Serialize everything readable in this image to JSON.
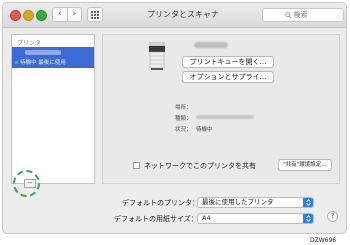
{
  "window": {
    "title": "プリンタとスキャナ",
    "nav_back": "‹",
    "nav_forward": "›"
  },
  "search": {
    "placeholder": "検索"
  },
  "sidebar": {
    "header": "プリンタ",
    "printer_status": "待機中 最後に使用",
    "remove_label": "−"
  },
  "detail": {
    "open_queue_label": "プリントキューを開く…",
    "options_label": "オプションとサプライ…",
    "location_label": "場所：",
    "kind_label": "種類：",
    "status_label": "状況：",
    "status_value": "待機中"
  },
  "share": {
    "label": "ネットワークでこのプリンタを共有",
    "settings_label": "\"共有\"環境設定…"
  },
  "defaults": {
    "printer_label": "デフォルトのプリンタ：",
    "printer_value": "最後に使用したプリンタ",
    "paper_label": "デフォルトの用紙サイズ：",
    "paper_value": "A4"
  },
  "help_label": "?",
  "figure_id": "DZW696",
  "colors": {
    "accent": "#3d6bd6",
    "select_arrow": "#2f7ef2",
    "callout": "#38a84a"
  },
  "icons": [
    "close-traffic-light",
    "minimize-traffic-light",
    "zoom-traffic-light",
    "back-arrow-icon",
    "forward-arrow-icon",
    "grid-icon",
    "search-icon",
    "printer-icon",
    "chevron-updown-icon",
    "help-icon"
  ]
}
